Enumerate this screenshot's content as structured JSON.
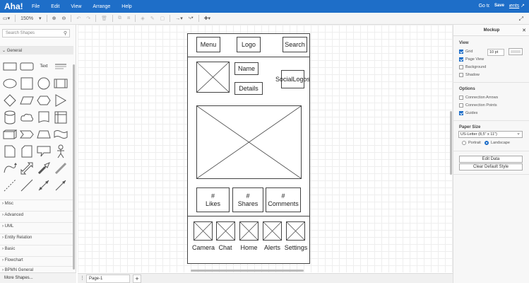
{
  "app": {
    "logo": "Aha!",
    "menu": [
      "File",
      "Edit",
      "View",
      "Arrange",
      "Help"
    ],
    "goto_prefix": "Go to",
    "goto_link": "Attachments",
    "goto_icon": "external-link-icon"
  },
  "toolbar": {
    "zoom": "150%",
    "save_label": "Save"
  },
  "sidebar": {
    "search_placeholder": "Search Shapes",
    "general_label": "General",
    "text_shape_label": "Text",
    "sections": [
      "Misc",
      "Advanced",
      "UML",
      "Entity Relation",
      "Basic",
      "Flowchart",
      "BPMN General"
    ],
    "more_shapes": "More Shapes..."
  },
  "mockup": {
    "menu": "Menu",
    "logo": "Logo",
    "search": "Search",
    "name": "Name",
    "details": "Details",
    "social_line1": "Social",
    "social_line2": "Logos",
    "likes_hash": "#",
    "likes": "Likes",
    "shares_hash": "#",
    "shares": "Shares",
    "comments_hash": "#",
    "comments": "Comments",
    "nav": [
      "Camera",
      "Chat",
      "Home",
      "Alerts",
      "Settings"
    ]
  },
  "pages": {
    "current": "Page-1"
  },
  "panel": {
    "title": "Mockup",
    "view_label": "View",
    "grid_label": "Grid",
    "grid_value": "10 pt",
    "page_view_label": "Page View",
    "background_label": "Background",
    "shadow_label": "Shadow",
    "options_label": "Options",
    "connection_arrows": "Connection Arrows",
    "connection_points": "Connection Points",
    "guides": "Guides",
    "paper_size_label": "Paper Size",
    "paper_size_value": "US-Letter (8,5\" x 11\")",
    "portrait": "Portrait",
    "landscape": "Landscape",
    "edit_data": "Edit Data",
    "clear_default_style": "Clear Default Style"
  },
  "colors": {
    "accent": "#1e6ec8",
    "topbar": "#1e6ec8"
  }
}
